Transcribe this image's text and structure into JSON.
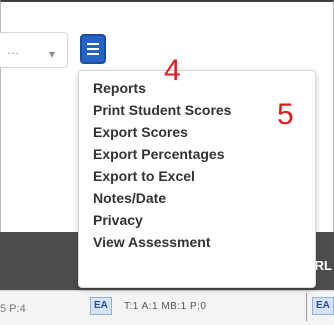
{
  "toolbar": {
    "dropdown_value": "...",
    "dropdown_arrow": "▾",
    "menu_button_icon": "hamburger-icon"
  },
  "menu": {
    "items": [
      "Reports",
      "Print Student Scores",
      "Export Scores",
      "Export Percentages",
      "Export to Excel",
      "Notes/Date",
      "Privacy",
      "View Assessment"
    ]
  },
  "annotations": {
    "step_4": "4",
    "step_5": "5"
  },
  "header_strip": {
    "text": "RL"
  },
  "bottom_row": {
    "left_text": "5 P:4",
    "badge": "EA",
    "stats": "T:1  A:1  MB:1  P:0",
    "badge_right": "EA"
  },
  "colors": {
    "accent_button": "#2563c4",
    "annotation_red": "#e51b1b",
    "dark_strip": "#4d4d4d"
  }
}
